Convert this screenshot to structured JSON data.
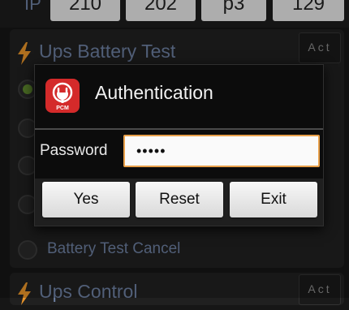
{
  "ip": {
    "label": "IP",
    "octets": [
      "210",
      "202",
      "p3",
      "129"
    ]
  },
  "battery_test": {
    "title": "Ups Battery Test",
    "act_label": "Act",
    "last_option": "Battery Test Cancel",
    "selected_index": 0
  },
  "ups_control": {
    "title": "Ups Control",
    "act_label": "Act"
  },
  "dialog": {
    "title": "Authentication",
    "icon_text": "PCM",
    "password_label": "Password",
    "password_value": "•••••",
    "buttons": {
      "yes": "Yes",
      "reset": "Reset",
      "exit": "Exit"
    }
  },
  "colors": {
    "accent_orange": "#e8a04a",
    "section_text": "#6d7fa1",
    "bolt": "#e8942a",
    "icon_red": "#d42a2a",
    "radio_on": "#5f8a2e"
  }
}
